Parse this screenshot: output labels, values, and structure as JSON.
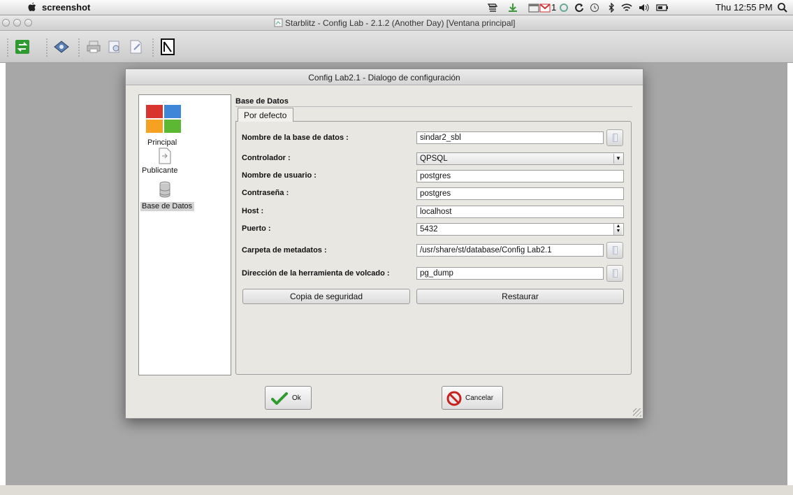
{
  "menubar": {
    "app_name": "screenshot",
    "clock": "Thu 12:55 PM",
    "mail_count": "1"
  },
  "window": {
    "title": "Starblitz - Config Lab - 2.1.2 (Another Day) [Ventana principal]"
  },
  "toolbar": {
    "icons": [
      "exchange-icon",
      "view-icon",
      "print-icon",
      "print-preview-icon",
      "edit-icon",
      "notebook-icon"
    ]
  },
  "dialog": {
    "title": "Config Lab2.1 - Dialogo de configuración",
    "sidebar": {
      "items": [
        {
          "label": "Principal",
          "icon": "windows-grid-icon"
        },
        {
          "label": "Publicante",
          "icon": "document-arrow-icon"
        },
        {
          "label": "Base de Datos",
          "icon": "database-icon"
        }
      ],
      "selected": "Base de Datos"
    },
    "section_title": "Base de Datos",
    "tab_label": "Por defecto",
    "fields": {
      "db_name": {
        "label": "Nombre de la base de datos :",
        "value": "sindar2_sbl"
      },
      "driver": {
        "label": "Controlador :",
        "value": "QPSQL"
      },
      "user": {
        "label": "Nombre de usuario :",
        "value": "postgres"
      },
      "password": {
        "label": "Contraseña :",
        "value": "postgres"
      },
      "host": {
        "label": "Host :",
        "value": "localhost"
      },
      "port": {
        "label": "Puerto :",
        "value": "5432"
      },
      "metadata_folder": {
        "label": "Carpeta de metadatos :",
        "value": "/usr/share/st/database/Config Lab2.1"
      },
      "dump_tool": {
        "label": "Dirección de la herramienta de volcado :",
        "value": "pg_dump"
      }
    },
    "backup_button": "Copia de seguridad",
    "restore_button": "Restaurar",
    "ok_button": "Ok",
    "cancel_button": "Cancelar"
  }
}
